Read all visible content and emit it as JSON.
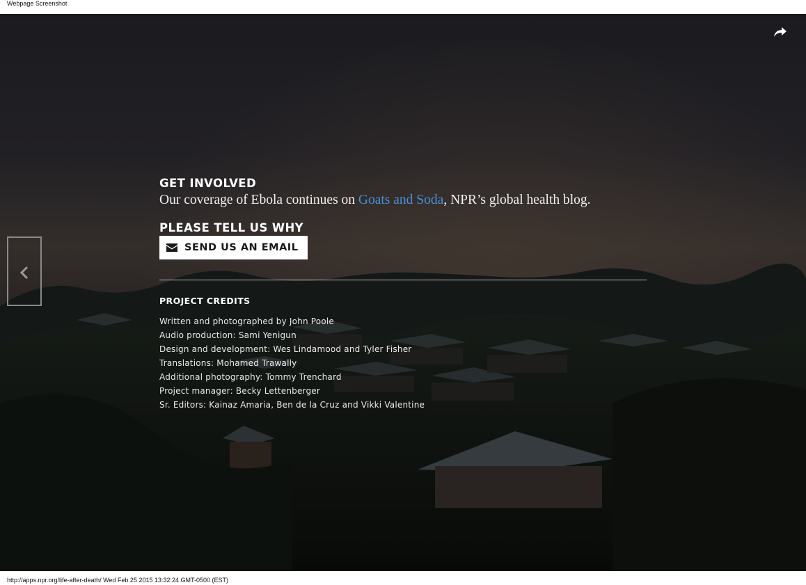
{
  "screenshot": {
    "caption_top": "Webpage Screenshot",
    "caption_bottom": "http://apps.npr.org/life-after-death/ Wed Feb 25 2015 13:32:24 GMT-0500 (EST)"
  },
  "colors": {
    "link": "#4a8fd8",
    "text": "#ffffff",
    "button_bg": "#ffffff",
    "button_text": "#1a1a1a"
  },
  "share": {
    "icon": "share-arrow-icon"
  },
  "nav": {
    "prev_icon": "chevron-left-icon"
  },
  "get_involved": {
    "heading": "GET INVOLVED",
    "text_before": "Our coverage of Ebola continues on ",
    "link_text": "Goats and Soda",
    "text_after": ", NPR’s global health blog."
  },
  "feedback": {
    "heading": "PLEASE TELL US WHY",
    "button_label": "SEND US AN EMAIL",
    "button_icon": "envelope-icon"
  },
  "credits": {
    "heading": "PROJECT CREDITS",
    "items": [
      "Written and photographed by John Poole",
      "Audio production: Sami Yenigun",
      "Design and development: Wes Lindamood and Tyler Fisher",
      "Translations: Mohamed Trawally",
      "Additional photography: Tommy Trenchard",
      "Project manager: Becky Lettenberger",
      "Sr. Editors: Kainaz Amaria, Ben de la Cruz and Vikki Valentine"
    ]
  }
}
